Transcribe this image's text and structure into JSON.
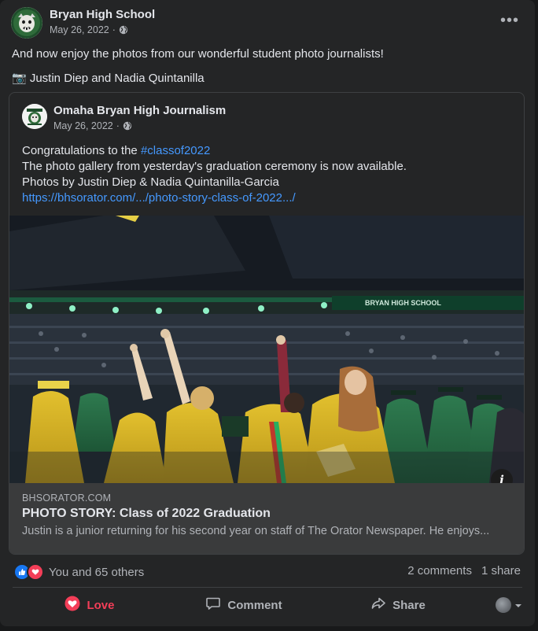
{
  "post": {
    "author": "Bryan High School",
    "date": "May 26, 2022",
    "separator": "·",
    "more_label": "•••",
    "text_line1": "And now enjoy the photos from our wonderful student photo journalists!",
    "text_line2": "📷 Justin Diep and Nadia Quintanilla"
  },
  "shared": {
    "author": "Omaha Bryan High Journalism",
    "date": "May 26, 2022",
    "separator": "·",
    "line1_prefix": "Congratulations to the ",
    "hashtag": "#classof2022",
    "line2": "The photo gallery from yesterday's graduation ceremony is now available.",
    "line3": "Photos by Justin Diep & Nadia Quintanilla-Garcia",
    "url": "https://bhsorator.com/.../photo-story-class-of-2022.../",
    "photo_banner": "BRYAN HIGH SCHOOL",
    "info_label": "i"
  },
  "link_preview": {
    "domain": "BHSORATOR.COM",
    "title": "PHOTO STORY: Class of 2022 Graduation",
    "description": "Justin is a junior returning for his second year on staff of The Orator Newspaper. He enjoys..."
  },
  "engagement": {
    "reactions_text": "You and 65 others",
    "comments": "2 comments",
    "shares": "1 share"
  },
  "actions": {
    "love": "Love",
    "comment": "Comment",
    "share": "Share"
  },
  "colors": {
    "background": "#18191a",
    "card": "#242526",
    "text_primary": "#e4e6eb",
    "text_secondary": "#b0b3b8",
    "link": "#4599ff",
    "love": "#f33e58",
    "like": "#1877f2"
  },
  "icons": [
    "globe-icon",
    "more-icon",
    "like-reaction-icon",
    "love-reaction-icon",
    "heart-icon",
    "comment-icon",
    "share-icon",
    "chevron-down-icon",
    "info-icon"
  ]
}
